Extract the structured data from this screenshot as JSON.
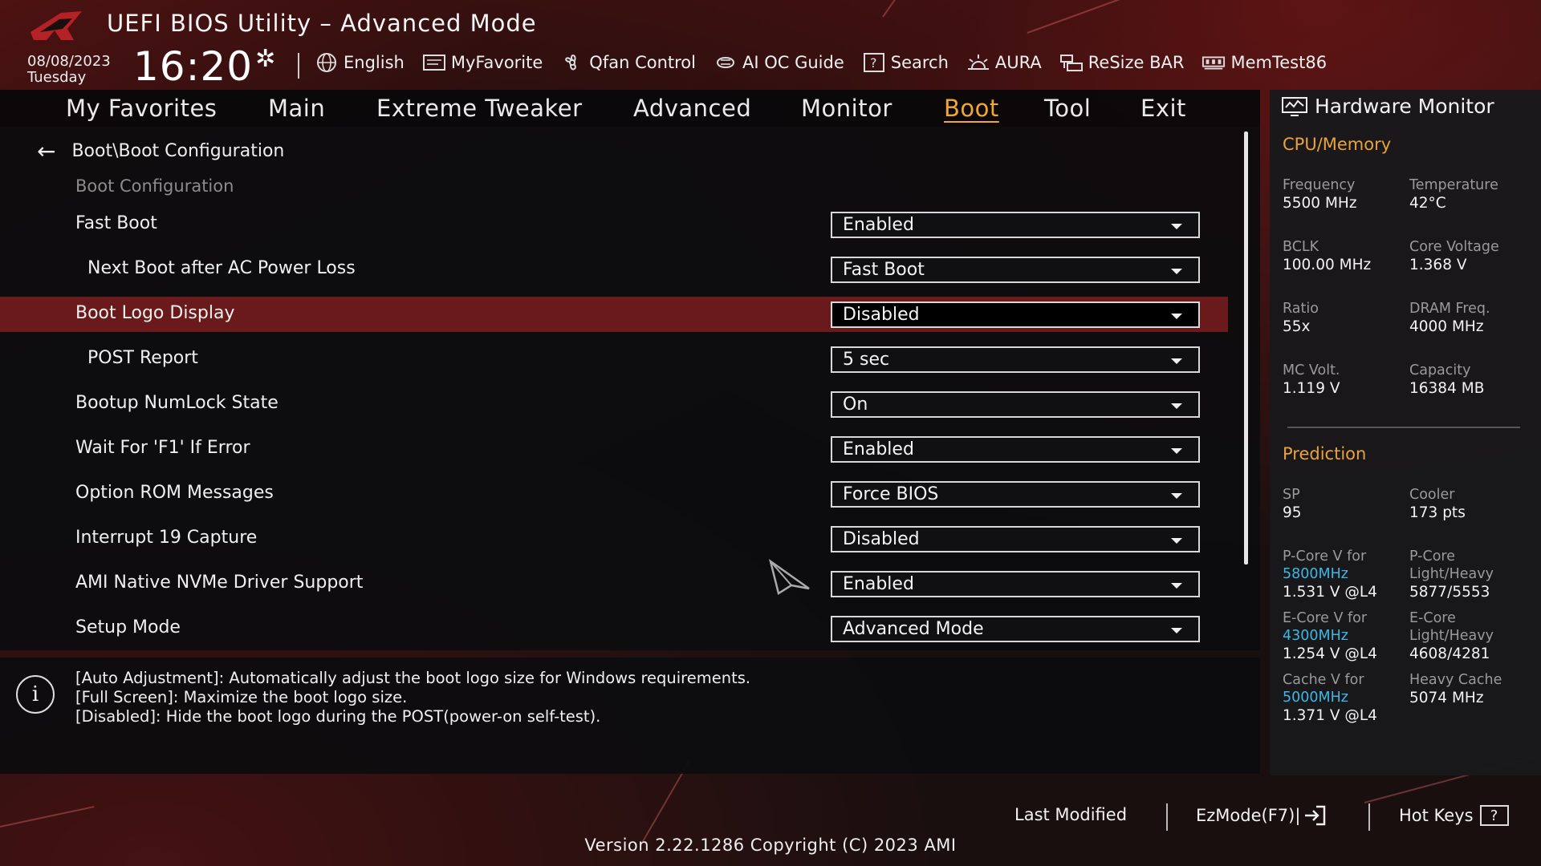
{
  "header": {
    "title": "UEFI BIOS Utility – Advanced Mode",
    "date": "08/08/2023",
    "day": "Tuesday",
    "time": "16:20",
    "toolbar": [
      {
        "label": "English",
        "icon": "globe-icon"
      },
      {
        "label": "MyFavorite",
        "icon": "favorite-icon"
      },
      {
        "label": "Qfan Control",
        "icon": "fan-icon"
      },
      {
        "label": "AI OC Guide",
        "icon": "ai-icon"
      },
      {
        "label": "Search",
        "icon": "search-icon"
      },
      {
        "label": "AURA",
        "icon": "aura-icon"
      },
      {
        "label": "ReSize BAR",
        "icon": "resize-bar-icon"
      },
      {
        "label": "MemTest86",
        "icon": "memory-icon"
      }
    ]
  },
  "nav": {
    "tabs": [
      "My Favorites",
      "Main",
      "Extreme Tweaker",
      "Advanced",
      "Monitor",
      "Boot",
      "Tool",
      "Exit"
    ],
    "active": "Boot"
  },
  "main": {
    "breadcrumb": "Boot\\Boot Configuration",
    "section": "Boot Configuration",
    "settings": [
      {
        "label": "Fast Boot",
        "value": "Enabled"
      },
      {
        "label": "Next Boot after AC Power Loss",
        "value": "Fast Boot"
      },
      {
        "label": "Boot Logo Display",
        "value": "Disabled"
      },
      {
        "label": "POST Report",
        "value": "5 sec"
      },
      {
        "label": "Bootup NumLock State",
        "value": "On"
      },
      {
        "label": "Wait For 'F1' If Error",
        "value": "Enabled"
      },
      {
        "label": "Option ROM Messages",
        "value": "Force BIOS"
      },
      {
        "label": "Interrupt 19 Capture",
        "value": "Disabled"
      },
      {
        "label": "AMI Native NVMe Driver Support",
        "value": "Enabled"
      },
      {
        "label": "Setup Mode",
        "value": "Advanced Mode"
      }
    ],
    "selected_setting": "Boot Logo Display"
  },
  "info": {
    "lines": [
      "[Auto Adjustment]: Automatically adjust the boot logo size for Windows requirements.",
      "[Full Screen]: Maximize the boot logo size.",
      "[Disabled]: Hide the boot logo during the POST(power-on self-test)."
    ]
  },
  "hardware_monitor": {
    "title": "Hardware Monitor",
    "cpu_memory": {
      "heading": "CPU/Memory",
      "items": [
        {
          "label": "Frequency",
          "value": "5500 MHz"
        },
        {
          "label": "Temperature",
          "value": "42°C"
        },
        {
          "label": "BCLK",
          "value": "100.00 MHz"
        },
        {
          "label": "Core Voltage",
          "value": "1.368 V"
        },
        {
          "label": "Ratio",
          "value": "55x"
        },
        {
          "label": "DRAM Freq.",
          "value": "4000 MHz"
        },
        {
          "label": "MC Volt.",
          "value": "1.119 V"
        },
        {
          "label": "Capacity",
          "value": "16384 MB"
        }
      ]
    },
    "prediction": {
      "heading": "Prediction",
      "sp_label": "SP",
      "sp_value": "95",
      "cooler_label": "Cooler",
      "cooler_value": "173 pts",
      "pcore_v_label": "P-Core V for",
      "pcore_v_freq": "5800MHz",
      "pcore_v_value": "1.531 V @L4",
      "pcore_lh_label_1": "P-Core",
      "pcore_lh_label_2": "Light/Heavy",
      "pcore_lh_value": "5877/5553",
      "ecore_v_label": "E-Core V for",
      "ecore_v_freq": "4300MHz",
      "ecore_v_value": "1.254 V @L4",
      "ecore_lh_label_1": "E-Core",
      "ecore_lh_label_2": "Light/Heavy",
      "ecore_lh_value": "4608/4281",
      "cache_v_label": "Cache V for",
      "cache_v_freq": "5000MHz",
      "cache_v_value": "1.371 V @L4",
      "heavy_cache_label": "Heavy Cache",
      "heavy_cache_value": "5074 MHz"
    }
  },
  "footer": {
    "last_modified": "Last Modified",
    "ezmode": "EzMode(F7)|",
    "hotkeys": "Hot Keys",
    "hotkeys_key": "?",
    "version": "Version 2.22.1286 Copyright (C) 2023 AMI"
  },
  "colors": {
    "accent": "#f0a830",
    "selected_row": "#6a1a1a",
    "frequency_blue": "#3fb7e6"
  }
}
